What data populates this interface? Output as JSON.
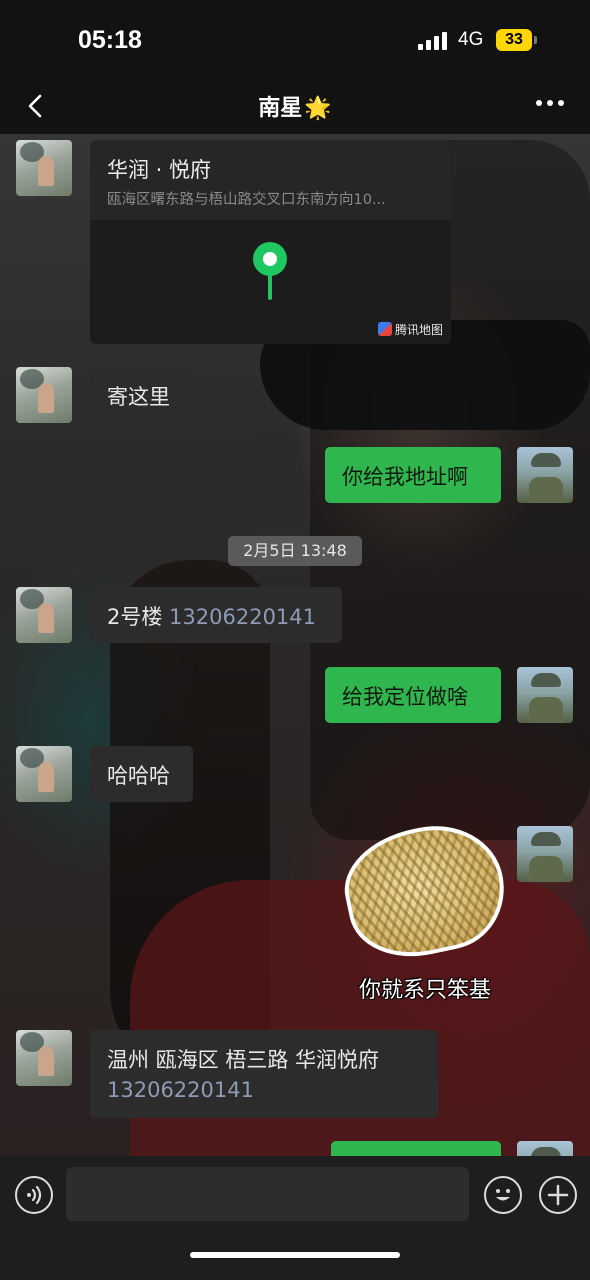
{
  "status_bar": {
    "time": "05:18",
    "network": "4G",
    "battery": "33",
    "battery_color": "#ffd60a"
  },
  "nav": {
    "back_icon": "chevron-left-icon",
    "title": "南星",
    "title_emoji": "🌟",
    "more_icon": "ellipsis-icon"
  },
  "colors": {
    "outgoing_bubble": "#2fb64e",
    "incoming_bubble": "#2c2c2c",
    "phone_link": "#8f9bb5",
    "map_pin": "#1ec760"
  },
  "messages": {
    "location": {
      "name": "华润 · 悦府",
      "address": "瓯海区曙东路与梧山路交叉口东南方向10...",
      "map_provider": "腾讯地图"
    },
    "m1": {
      "text": "寄这里"
    },
    "m2": {
      "text": "你给我地址啊"
    },
    "timestamp": "2月5日 13:48",
    "m3": {
      "text": "2号楼 ",
      "phone": "13206220141"
    },
    "m4": {
      "text": "给我定位做啥"
    },
    "m5": {
      "text": "哈哈哈"
    },
    "sticker": {
      "caption": "你就系只笨基"
    },
    "m6": {
      "text": "温州 瓯海区 梧三路  华润悦府",
      "phone": "13206220141"
    }
  },
  "input_bar": {
    "voice_icon": "voice-icon",
    "emoji_icon": "emoji-icon",
    "plus_icon": "plus-icon"
  }
}
